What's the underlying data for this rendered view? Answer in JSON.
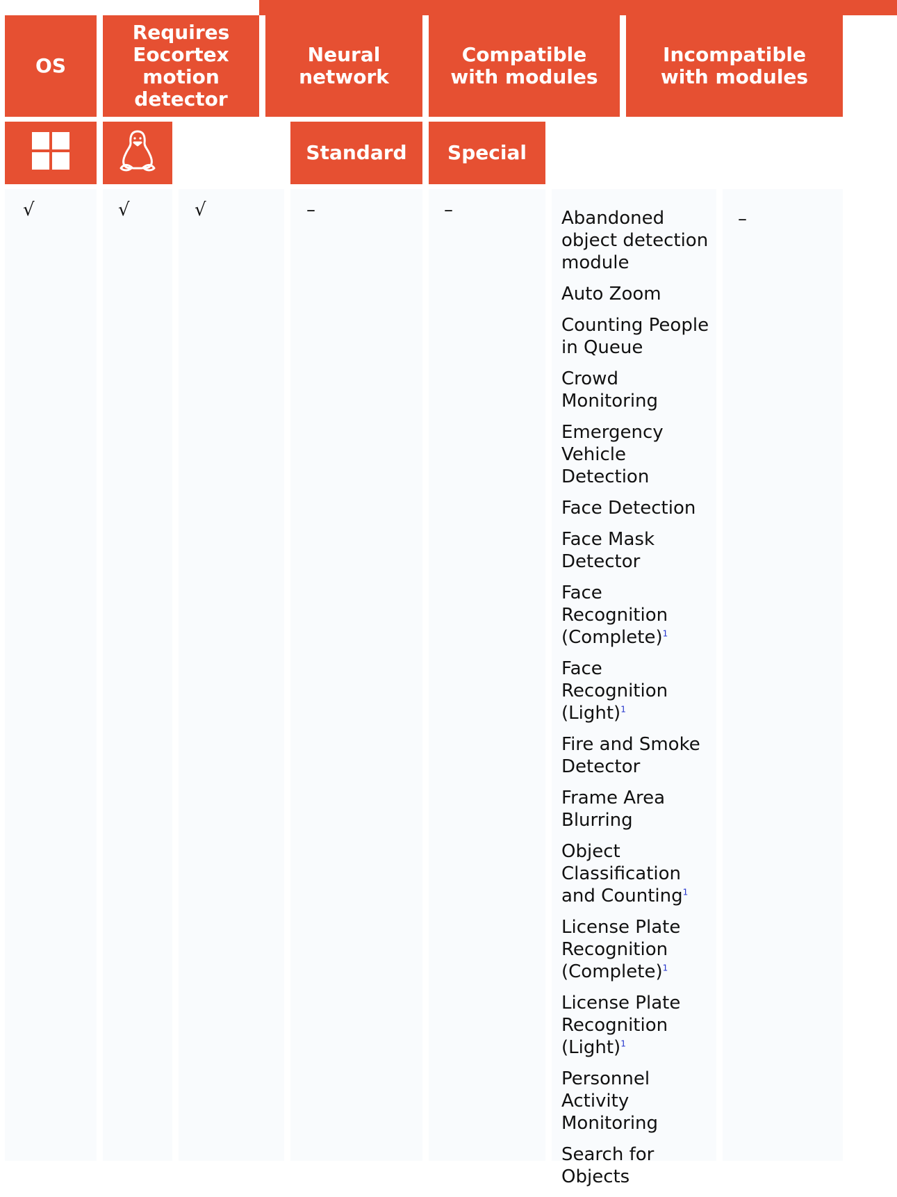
{
  "header": {
    "os": "OS",
    "eocortex": "Requires Eocortex motion detector",
    "neural": "Neural network",
    "compatible": "Compatible with modules",
    "incompatible": "Incompatible with modules",
    "standard": "Standard",
    "special": "Special"
  },
  "icons": {
    "windows": "windows-logo-icon",
    "linux": "linux-penguin-icon"
  },
  "row": {
    "windows": "√",
    "linux": "√",
    "eocortex": "√",
    "standard": "–",
    "special": "–",
    "incompatible": "–"
  },
  "compatible_modules": [
    {
      "name": "Abandoned object detection module",
      "fn": ""
    },
    {
      "name": "Auto Zoom",
      "fn": ""
    },
    {
      "name": "Counting People in Queue",
      "fn": ""
    },
    {
      "name": "Crowd Monitoring",
      "fn": ""
    },
    {
      "name": "Emergency Vehicle Detection",
      "fn": ""
    },
    {
      "name": "Face Detection",
      "fn": ""
    },
    {
      "name": "Face Mask Detector",
      "fn": ""
    },
    {
      "name": "Face Recognition (Complete)",
      "fn": "1"
    },
    {
      "name": "Face Recognition (Light)",
      "fn": "1"
    },
    {
      "name": "Fire and Smoke Detector",
      "fn": ""
    },
    {
      "name": "Frame Area Blurring",
      "fn": ""
    },
    {
      "name": "Object Classification and Counting",
      "fn": "1"
    },
    {
      "name": "License Plate Recognition (Complete)",
      "fn": "1"
    },
    {
      "name": "License Plate Recognition (Light)",
      "fn": "1"
    },
    {
      "name": "Personnel Activity Monitoring",
      "fn": ""
    },
    {
      "name": "Search for Objects",
      "fn": ""
    }
  ],
  "colors": {
    "header_bg": "#e65032",
    "header_text": "#ffffff",
    "column_bg": "#f9fbfd",
    "footnote_link": "#2233cc"
  }
}
